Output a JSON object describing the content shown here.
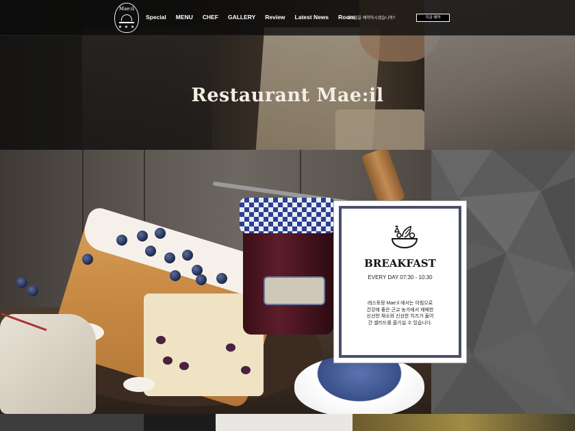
{
  "brand": {
    "logo_text": "Mae:il",
    "logo_stars": "★ ★ ★"
  },
  "nav": {
    "items": [
      {
        "label": "Special"
      },
      {
        "label": "MENU"
      },
      {
        "label": "CHEF"
      },
      {
        "label": "GALLERY"
      },
      {
        "label": "Review"
      },
      {
        "label": "Latest News"
      },
      {
        "label": "Room"
      }
    ],
    "question": "테이블을 예약하시겠습니까?",
    "cta_label": "지금 예약"
  },
  "hero": {
    "title": "Restaurant Mae:il"
  },
  "card": {
    "icon": "salad-bowl-icon",
    "title": "BREAKFAST",
    "hours": "EVERY DAY 07:30 - 10:30",
    "desc_lines": [
      "레스토랑 Mae:il 에서는 아침으로",
      "건강에 좋은 근교 농가에서 재배한",
      "신선한 채소와 신선한 치즈가 들어",
      "간 샐러드를 즐기실 수 있습니다."
    ]
  },
  "colors": {
    "nav_bg": "#0a0a0a",
    "card_border": "#4a4f67",
    "stone_bg": "#5c5c5c",
    "text_light": "#f4ede4"
  }
}
